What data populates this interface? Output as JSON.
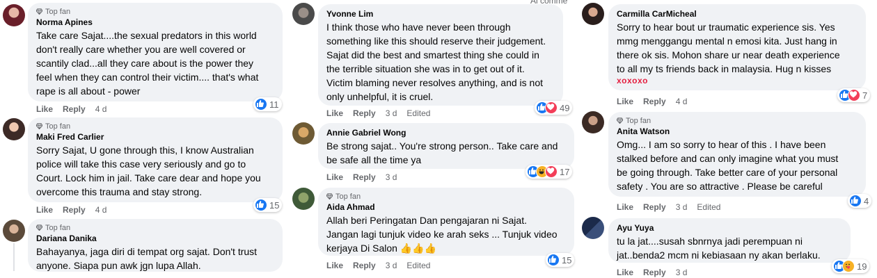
{
  "header_fragment": "Al comme",
  "colors": {
    "like": "#1877f2",
    "love": "#f33e58",
    "haha": "#f7b125",
    "xoxo": "#e41e3f"
  },
  "col1": [
    {
      "top_fan": "Top fan",
      "author": "Norma Apines",
      "text": "Take care Sajat....the sexual predators in this world\ndon't really care whether you are well covered or\nscantily clad...all they care about is the power they\nfeel when they can control their victim.... that's what\nrape is all about - power",
      "like": "Like",
      "reply": "Reply",
      "time": "4 d",
      "reactions": [
        "like"
      ],
      "count": "11"
    },
    {
      "top_fan": "Top fan",
      "author": "Maki Fred Carlier",
      "text": "Sorry Sajat, U gone through this, I know Australian\npolice will take this case very seriously and go to\nCourt. Lock him in jail. Take care dear and hope you\novercome this trauma and stay strong.",
      "like": "Like",
      "reply": "Reply",
      "time": "4 d",
      "reactions": [
        "like"
      ],
      "count": "15"
    },
    {
      "top_fan": "Top fan",
      "author": "Dariana Danika",
      "text": "Bahayanya, jaga diri di tempat org sajat. Don't trust\nanyone. Siapa pun awk jgn lupa Allah."
    }
  ],
  "col2": [
    {
      "author": "Yvonne Lim",
      "text": "I think those who have never been through\nsomething like this should reserve their judgement.\nSajat did the best and smartest thing she could in\nthe terrible situation she was in to get out of it.\nVictim blaming never resolves anything, and is not\nonly unhelpful, it is cruel.",
      "like": "Like",
      "reply": "Reply",
      "time": "3 d",
      "edited": "Edited",
      "reactions": [
        "like",
        "love"
      ],
      "count": "49"
    },
    {
      "author": "Annie Gabriel Wong",
      "text": "Be strong sajat.. You're strong person.. Take care and\nbe safe all the time ya",
      "like": "Like",
      "reply": "Reply",
      "time": "3 d",
      "reactions": [
        "like",
        "haha",
        "love"
      ],
      "count": "17"
    },
    {
      "top_fan": "Top fan",
      "author": "Aida Ahmad",
      "text": "Allah beri Peringatan Dan pengajaran ni Sajat.\nJangan lagi tunjuk video ke arah seks ... Tunjuk video\nkerjaya Di Salon 👍👍👍",
      "like": "Like",
      "reply": "Reply",
      "time": "3 d",
      "edited": "Edited",
      "reactions": [
        "like"
      ],
      "count": "15"
    }
  ],
  "col3": [
    {
      "author": "Carmilla CarMicheal",
      "text": "Sorry to hear bout ur traumatic experience sis. Yes\nmmg menggangu mental n emosi kita. Just hang in\nthere ok sis. Mohon share ur near death experience\nto all my ts friends back in malaysia. Hug n kisses",
      "xoxo": "xoxoxo",
      "like": "Like",
      "reply": "Reply",
      "time": "4 d",
      "reactions": [
        "like",
        "love"
      ],
      "count": "7"
    },
    {
      "top_fan": "Top fan",
      "author": "Anita Watson",
      "text": "Omg... I am so sorry to hear of this . I have been\nstalked before and can only imagine what you must\nbe going through. Take better care of your personal\nsafety . You are so attractive . Please be careful",
      "like": "Like",
      "reply": "Reply",
      "time": "3 d",
      "edited": "Edited",
      "reactions": [
        "like"
      ],
      "count": "4"
    },
    {
      "author": "Ayu Yuya",
      "text": "tu la jat....susah sbnrnya jadi perempuan ni\njat..benda2 mcm ni kebiasaan ny akan berlaku.",
      "like": "Like",
      "reply": "Reply",
      "time": "3 d",
      "reactions": [
        "like",
        "care"
      ],
      "count": "19"
    }
  ]
}
